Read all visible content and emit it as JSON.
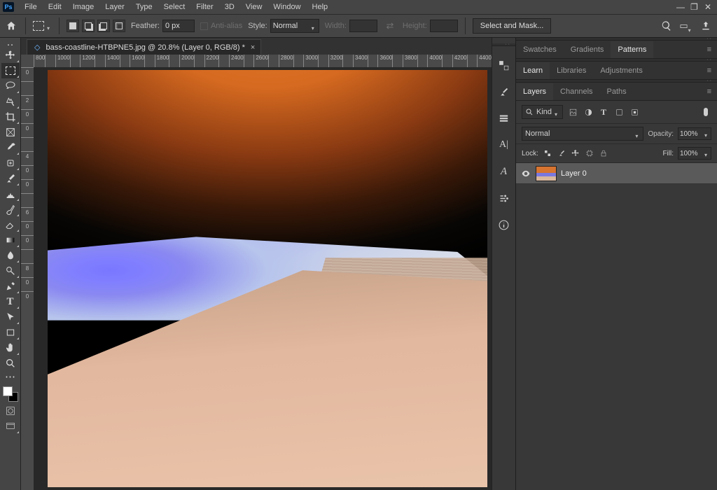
{
  "menu": {
    "items": [
      "File",
      "Edit",
      "Image",
      "Layer",
      "Type",
      "Select",
      "Filter",
      "3D",
      "View",
      "Window",
      "Help"
    ]
  },
  "optionsbar": {
    "feather_label": "Feather:",
    "feather_value": "0 px",
    "antialias_label": "Anti-alias",
    "style_label": "Style:",
    "style_value": "Normal",
    "width_label": "Width:",
    "height_label": "Height:",
    "select_mask": "Select and Mask..."
  },
  "document": {
    "tab_title": "bass-coastline-HTBPNE5.jpg @ 20.8% (Layer 0, RGB/8) *",
    "ruler_h": [
      "800",
      "",
      "1000",
      "",
      "1200",
      "",
      "1400",
      "",
      "1600",
      "",
      "1800",
      "",
      "2000",
      "",
      "2200",
      "",
      "2400",
      "",
      "2600",
      "",
      "2800",
      "",
      "3000",
      "",
      "3200",
      "",
      "3400",
      "",
      "3600",
      "",
      "3800",
      "",
      "4000",
      "",
      "4200",
      "",
      "4400"
    ],
    "ruler_v": [
      "0",
      "",
      "2",
      "0",
      "0",
      "",
      "4",
      "0",
      "0",
      "",
      "6",
      "0",
      "0",
      "",
      "8",
      "0",
      "0"
    ]
  },
  "panels": {
    "swatches_tabs": [
      "Swatches",
      "Gradients",
      "Patterns"
    ],
    "swatches_active": 2,
    "learn_tabs": [
      "Learn",
      "Libraries",
      "Adjustments"
    ],
    "learn_active": 0,
    "layers_tabs": [
      "Layers",
      "Channels",
      "Paths"
    ],
    "layers_active": 0,
    "kind_label": "Kind",
    "blend_mode": "Normal",
    "opacity_label": "Opacity:",
    "opacity_value": "100%",
    "lock_label": "Lock:",
    "fill_label": "Fill:",
    "fill_value": "100%",
    "layers": [
      {
        "name": "Layer 0"
      }
    ]
  }
}
